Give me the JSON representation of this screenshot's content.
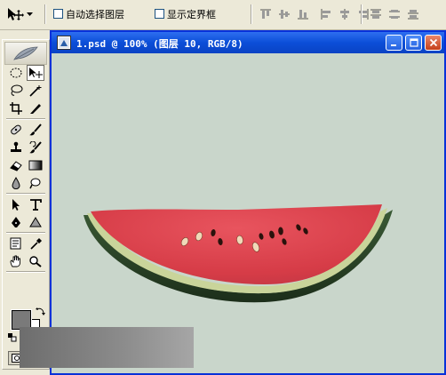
{
  "options_bar": {
    "auto_select_label": "自动选择图层",
    "show_bounds_label": "显示定界框",
    "auto_select_checked": false,
    "show_bounds_checked": false,
    "align_buttons": [
      "align-top-edges-icon",
      "align-vertical-centers-icon",
      "align-bottom-edges-icon",
      "align-left-edges-icon",
      "align-horizontal-centers-icon",
      "align-right-edges-icon"
    ],
    "distribute_buttons": [
      "distribute-top-icon",
      "distribute-vcenter-icon",
      "distribute-bottom-icon"
    ]
  },
  "toolbox": {
    "active_tool": "move-tool",
    "foreground_color": "#7a7a7a",
    "background_color": "#ffffff"
  },
  "document": {
    "title": "1.psd @ 100% (图层 10, RGB/8)",
    "canvas_color": "#c9d6cb",
    "titlebar_color": "#0b4ed8"
  }
}
